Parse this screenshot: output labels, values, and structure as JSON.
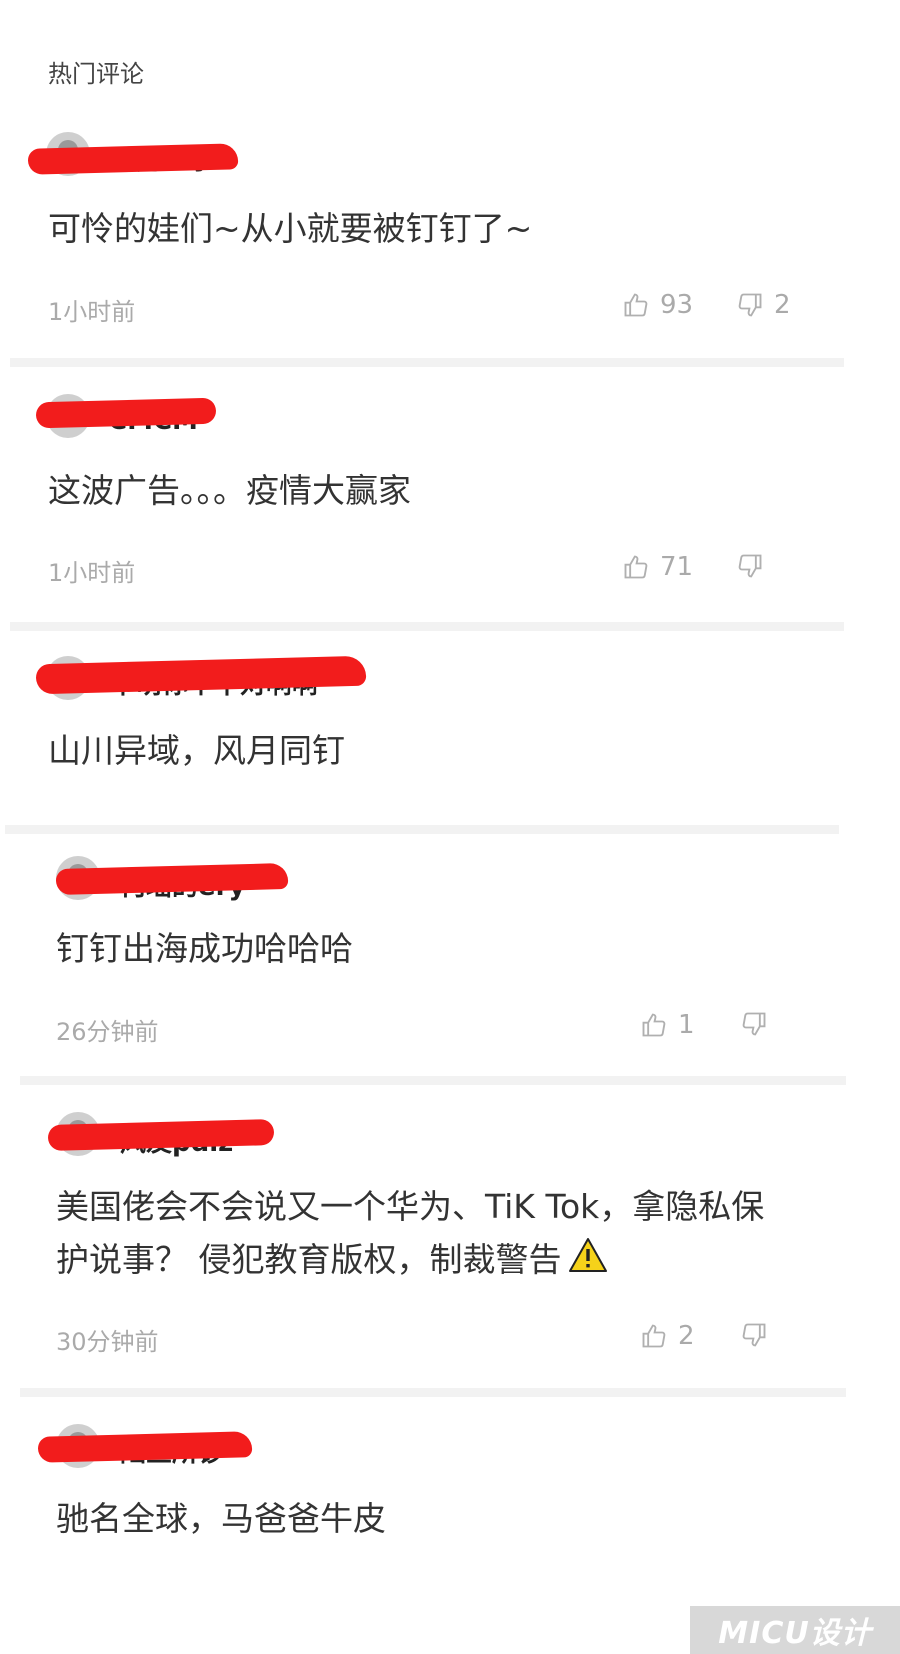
{
  "header": {
    "title": "热门评论"
  },
  "comments": [
    {
      "user": "贝勇兰尔",
      "content": "可怜的娃们~从小就要被钉钉了~",
      "time": "1小时前",
      "likes": "93",
      "dislikes": "2"
    },
    {
      "user": "CMCM",
      "content": "这波广告。。。疫情大赢家",
      "time": "1小时前",
      "likes": "71",
      "dislikes": ""
    },
    {
      "user": "千萌你个不对啊啊",
      "content": "山川异域，风月同钉"
    },
    {
      "user": "何瑶的ery",
      "content": "钉钉出海成功哈哈哈",
      "time": "26分钟前",
      "likes": "1",
      "dislikes": ""
    },
    {
      "user": "风友pdiz",
      "content_line1": "美国佬会不会说又一个华为、TiK Tok，拿隐私保",
      "content_line2": "护说事？ 侵犯教育版权，制裁警告",
      "time": "30分钟前",
      "likes": "2",
      "dislikes": ""
    },
    {
      "user": "陆鱼所钞",
      "content": "驰名全球，马爸爸牛皮"
    }
  ],
  "watermark": {
    "text": "MICU设计"
  },
  "icons": {
    "like": "thumbs-up-icon",
    "dislike": "thumbs-down-icon",
    "warning": "warning-icon"
  },
  "colors": {
    "redaction": "#f21c1c",
    "separator": "#f2f2f2",
    "meta": "#aaaaaa",
    "warning": "#f5d21a"
  }
}
